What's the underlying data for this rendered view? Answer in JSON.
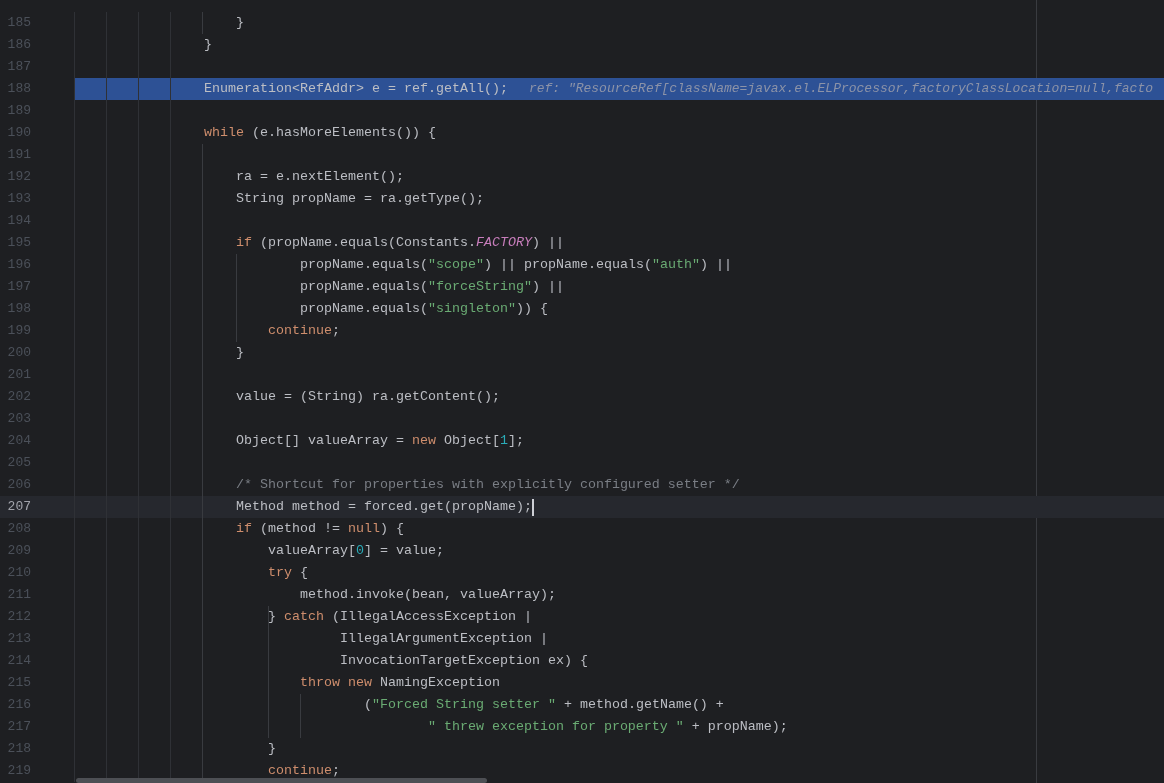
{
  "editor": {
    "lines": [
      {
        "number": "185",
        "selected": false,
        "caret": false,
        "code": [
          {
            "kind": "plain",
            "text": "                    }"
          }
        ]
      },
      {
        "number": "186",
        "selected": false,
        "caret": false,
        "code": [
          {
            "kind": "plain",
            "text": "                }"
          }
        ]
      },
      {
        "number": "187",
        "selected": false,
        "caret": false
      },
      {
        "number": "188",
        "selected": true,
        "caret": false,
        "code": [
          {
            "kind": "plain",
            "text": "                Enumeration<RefAddr> e = ref.getAll();"
          }
        ],
        "hint": "ref: \"ResourceRef[className=javax.el.ELProcessor,factoryClassLocation=null,facto"
      },
      {
        "number": "189",
        "selected": false,
        "caret": false
      },
      {
        "number": "190",
        "selected": false,
        "caret": false,
        "code": [
          {
            "kind": "keyword",
            "text": "                while"
          },
          {
            "kind": "plain",
            "text": " (e.hasMoreElements()) {"
          }
        ]
      },
      {
        "number": "191",
        "selected": false,
        "caret": false
      },
      {
        "number": "192",
        "selected": false,
        "caret": false,
        "code": [
          {
            "kind": "plain",
            "text": "                    ra = e.nextElement();"
          }
        ]
      },
      {
        "number": "193",
        "selected": false,
        "caret": false,
        "code": [
          {
            "kind": "plain",
            "text": "                    String propName = ra.getType();"
          }
        ]
      },
      {
        "number": "194",
        "selected": false,
        "caret": false
      },
      {
        "number": "195",
        "selected": false,
        "caret": false,
        "code": [
          {
            "kind": "keyword",
            "text": "                    if"
          },
          {
            "kind": "plain",
            "text": " (propName.equals(Constants."
          },
          {
            "kind": "constant",
            "text": "FACTORY"
          },
          {
            "kind": "plain",
            "text": ") ||"
          }
        ]
      },
      {
        "number": "196",
        "selected": false,
        "caret": false,
        "code": [
          {
            "kind": "plain",
            "text": "                            propName.equals("
          },
          {
            "kind": "string",
            "text": "\"scope\""
          },
          {
            "kind": "plain",
            "text": ") || propName.equals("
          },
          {
            "kind": "string",
            "text": "\"auth\""
          },
          {
            "kind": "plain",
            "text": ") ||"
          }
        ]
      },
      {
        "number": "197",
        "selected": false,
        "caret": false,
        "code": [
          {
            "kind": "plain",
            "text": "                            propName.equals("
          },
          {
            "kind": "string",
            "text": "\"forceString\""
          },
          {
            "kind": "plain",
            "text": ") ||"
          }
        ]
      },
      {
        "number": "198",
        "selected": false,
        "caret": false,
        "code": [
          {
            "kind": "plain",
            "text": "                            propName.equals("
          },
          {
            "kind": "string",
            "text": "\"singleton\""
          },
          {
            "kind": "plain",
            "text": ")) {"
          }
        ]
      },
      {
        "number": "199",
        "selected": false,
        "caret": false,
        "code": [
          {
            "kind": "keyword",
            "text": "                        continue"
          },
          {
            "kind": "plain",
            "text": ";"
          }
        ]
      },
      {
        "number": "200",
        "selected": false,
        "caret": false,
        "code": [
          {
            "kind": "plain",
            "text": "                    }"
          }
        ]
      },
      {
        "number": "201",
        "selected": false,
        "caret": false
      },
      {
        "number": "202",
        "selected": false,
        "caret": false,
        "code": [
          {
            "kind": "plain",
            "text": "                    value = (String) ra.getContent();"
          }
        ]
      },
      {
        "number": "203",
        "selected": false,
        "caret": false
      },
      {
        "number": "204",
        "selected": false,
        "caret": false,
        "code": [
          {
            "kind": "plain",
            "text": "                    Object[] valueArray = "
          },
          {
            "kind": "keyword",
            "text": "new"
          },
          {
            "kind": "plain",
            "text": " Object["
          },
          {
            "kind": "number",
            "text": "1"
          },
          {
            "kind": "plain",
            "text": "];"
          }
        ]
      },
      {
        "number": "205",
        "selected": false,
        "caret": false
      },
      {
        "number": "206",
        "selected": false,
        "caret": false,
        "code": [
          {
            "kind": "comment",
            "text": "                    /* Shortcut for properties with explicitly configured setter */"
          }
        ]
      },
      {
        "number": "207",
        "selected": false,
        "caret": true,
        "code": [
          {
            "kind": "plain",
            "text": "                    Method method = forced.get(propName);"
          }
        ]
      },
      {
        "number": "208",
        "selected": false,
        "caret": false,
        "code": [
          {
            "kind": "keyword",
            "text": "                    if"
          },
          {
            "kind": "plain",
            "text": " (method != "
          },
          {
            "kind": "keyword",
            "text": "null"
          },
          {
            "kind": "plain",
            "text": ") {"
          }
        ]
      },
      {
        "number": "209",
        "selected": false,
        "caret": false,
        "code": [
          {
            "kind": "plain",
            "text": "                        valueArray["
          },
          {
            "kind": "number",
            "text": "0"
          },
          {
            "kind": "plain",
            "text": "] = value;"
          }
        ]
      },
      {
        "number": "210",
        "selected": false,
        "caret": false,
        "code": [
          {
            "kind": "keyword",
            "text": "                        try"
          },
          {
            "kind": "plain",
            "text": " {"
          }
        ]
      },
      {
        "number": "211",
        "selected": false,
        "caret": false,
        "code": [
          {
            "kind": "plain",
            "text": "                            method.invoke(bean, valueArray);"
          }
        ]
      },
      {
        "number": "212",
        "selected": false,
        "caret": false,
        "code": [
          {
            "kind": "plain",
            "text": "                        } "
          },
          {
            "kind": "keyword",
            "text": "catch"
          },
          {
            "kind": "plain",
            "text": " (IllegalAccessException |"
          }
        ]
      },
      {
        "number": "213",
        "selected": false,
        "caret": false,
        "code": [
          {
            "kind": "plain",
            "text": "                                 IllegalArgumentException |"
          }
        ]
      },
      {
        "number": "214",
        "selected": false,
        "caret": false,
        "code": [
          {
            "kind": "plain",
            "text": "                                 InvocationTargetException ex) {"
          }
        ]
      },
      {
        "number": "215",
        "selected": false,
        "caret": false,
        "code": [
          {
            "kind": "keyword",
            "text": "                            throw new"
          },
          {
            "kind": "plain",
            "text": " NamingException"
          }
        ]
      },
      {
        "number": "216",
        "selected": false,
        "caret": false,
        "code": [
          {
            "kind": "plain",
            "text": "                                    ("
          },
          {
            "kind": "string",
            "text": "\"Forced String setter \""
          },
          {
            "kind": "plain",
            "text": " + method.getName() +"
          }
        ]
      },
      {
        "number": "217",
        "selected": false,
        "caret": false,
        "code": [
          {
            "kind": "string",
            "text": "                                            \" threw exception for property \""
          },
          {
            "kind": "plain",
            "text": " + propName);"
          }
        ]
      },
      {
        "number": "218",
        "selected": false,
        "caret": false,
        "code": [
          {
            "kind": "plain",
            "text": "                        }"
          }
        ]
      },
      {
        "number": "219",
        "selected": false,
        "caret": false,
        "code": [
          {
            "kind": "keyword",
            "text": "                        continue"
          },
          {
            "kind": "plain",
            "text": ";"
          }
        ]
      }
    ]
  }
}
